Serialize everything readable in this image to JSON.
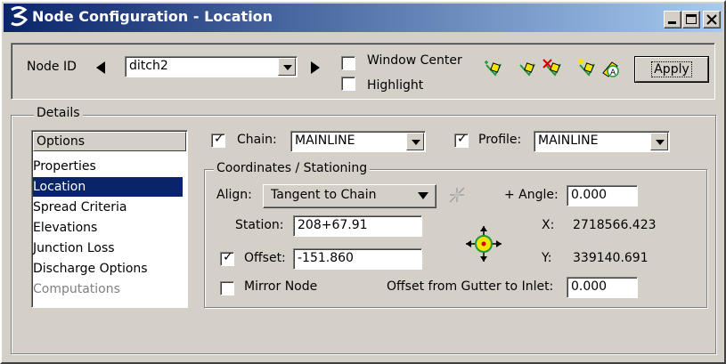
{
  "window": {
    "title": "Node Configuration - Location"
  },
  "header": {
    "node_id_label": "Node ID",
    "node_id_value": "ditch2",
    "window_center_label": "Window Center",
    "window_center_checked": false,
    "highlight_label": "Highlight",
    "highlight_checked": false,
    "apply_label": "Apply"
  },
  "details": {
    "legend": "Details",
    "options_header": "Options",
    "options": [
      {
        "label": "Properties",
        "selected": false,
        "enabled": true
      },
      {
        "label": "Location",
        "selected": true,
        "enabled": true
      },
      {
        "label": "Spread Criteria",
        "selected": false,
        "enabled": true
      },
      {
        "label": "Elevations",
        "selected": false,
        "enabled": true
      },
      {
        "label": "Junction Loss",
        "selected": false,
        "enabled": true
      },
      {
        "label": "Discharge Options",
        "selected": false,
        "enabled": true
      },
      {
        "label": "Computations",
        "selected": false,
        "enabled": false
      }
    ],
    "chain_label": "Chain:",
    "chain_checked": true,
    "chain_value": "MAINLINE",
    "profile_label": "Profile:",
    "profile_checked": true,
    "profile_value": "MAINLINE"
  },
  "coordinates": {
    "legend": "Coordinates / Stationing",
    "align_label": "Align:",
    "align_value": "Tangent to Chain",
    "angle_label": "+ Angle:",
    "angle_value": "0.000",
    "station_label": "Station:",
    "station_value": "208+67.91",
    "offset_label": "Offset:",
    "offset_checked": true,
    "offset_value": "-151.860",
    "x_label": "X:",
    "x_value": "2718566.423",
    "y_label": "Y:",
    "y_value": "339140.691",
    "mirror_label": "Mirror Node",
    "mirror_checked": false,
    "gutter_offset_label": "Offset from Gutter to Inlet:",
    "gutter_offset_value": "0.000"
  },
  "colors": {
    "title_gradient_start": "#0a246a",
    "title_gradient_end": "#a6caf0",
    "face": "#d4d0c8",
    "selection": "#0a246a",
    "icon_yellow": "#f5e400",
    "icon_green": "#1a9a3a",
    "icon_red": "#cc0000"
  }
}
